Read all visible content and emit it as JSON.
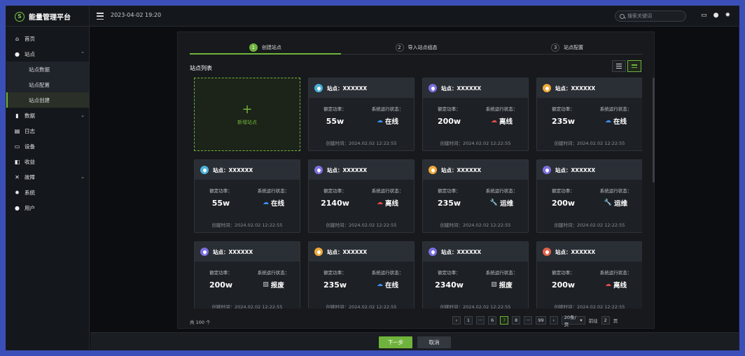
{
  "app": {
    "title": "能量管理平台"
  },
  "header": {
    "datetime": "2023-04-02 19:20",
    "search_placeholder": "搜索关键词"
  },
  "sidebar": {
    "items": [
      {
        "icon": "home-icon",
        "glyph": "⌂",
        "label": "首页"
      },
      {
        "icon": "location-icon",
        "glyph": "●",
        "label": "站点",
        "expanded": true,
        "children": [
          "站点数据",
          "站点配置",
          "站点创建"
        ]
      },
      {
        "icon": "bar-chart-icon",
        "glyph": "▮",
        "label": "数据",
        "collapsible": true
      },
      {
        "icon": "log-icon",
        "glyph": "▤",
        "label": "日志"
      },
      {
        "icon": "device-icon",
        "glyph": "▭",
        "label": "设备"
      },
      {
        "icon": "revenue-icon",
        "glyph": "◧",
        "label": "收益"
      },
      {
        "icon": "fault-icon",
        "glyph": "✕",
        "label": "故障",
        "collapsible": true
      },
      {
        "icon": "system-icon",
        "glyph": "✹",
        "label": "系统"
      },
      {
        "icon": "user-icon",
        "glyph": "●",
        "label": "用户"
      }
    ],
    "active_child": "站点创建"
  },
  "steps": [
    {
      "num": "1",
      "label": "创建站点",
      "active": true
    },
    {
      "num": "2",
      "label": "导入站点组态",
      "active": false
    },
    {
      "num": "3",
      "label": "站点配置",
      "active": false
    }
  ],
  "list": {
    "title": "站点列表",
    "new_label": "新增站点",
    "new_plus": "+"
  },
  "card_labels": {
    "power": "额定功率：",
    "status": "系统运行状态：",
    "created_prefix": "创建时间："
  },
  "cards": [
    {
      "name": "站点：XXXXXX",
      "pin_color": "#4ab2d8",
      "power": "55w",
      "status": "在线",
      "status_icon": "cloud-online-icon",
      "status_color": "#3d8ef0",
      "created": "2024.02.02 12:22:55"
    },
    {
      "name": "站点：XXXXXX",
      "pin_color": "#7b6fe0",
      "power": "200w",
      "status": "离线",
      "status_icon": "cloud-offline-icon",
      "status_color": "#e04b4b",
      "created": "2024.02.02 12:22:55"
    },
    {
      "name": "站点：XXXXXX",
      "pin_color": "#f0a93a",
      "power": "235w",
      "status": "在线",
      "status_icon": "cloud-online-icon",
      "status_color": "#3d8ef0",
      "created": "2024.02.02 12:22:55"
    },
    {
      "name": "站点：XXXXXX",
      "pin_color": "#4ab2d8",
      "power": "55w",
      "status": "在线",
      "status_icon": "cloud-online-icon",
      "status_color": "#3d8ef0",
      "created": "2024.02.02 12:22:55"
    },
    {
      "name": "站点：XXXXXX",
      "pin_color": "#7b6fe0",
      "power": "2140w",
      "status": "离线",
      "status_icon": "cloud-offline-icon",
      "status_color": "#e04b4b",
      "created": "2024.02.02 12:22:55"
    },
    {
      "name": "站点：XXXXXX",
      "pin_color": "#f0a93a",
      "power": "235w",
      "status": "运维",
      "status_icon": "wrench-icon",
      "status_color": "#f0b93a",
      "created": "2024.02.02 12:22:55"
    },
    {
      "name": "站点：XXXXXX",
      "pin_color": "#7b6fe0",
      "power": "200w",
      "status": "运维",
      "status_icon": "wrench-icon",
      "status_color": "#f0b93a",
      "created": "2024.02.02 12:22:55"
    },
    {
      "name": "站点：XXXXXX",
      "pin_color": "#7b6fe0",
      "power": "200w",
      "status": "报废",
      "status_icon": "scrapped-icon",
      "status_color": "#c5c9ce",
      "created": "2024.02.02 12:22:55"
    },
    {
      "name": "站点：XXXXXX",
      "pin_color": "#f0a93a",
      "power": "235w",
      "status": "在线",
      "status_icon": "cloud-online-icon",
      "status_color": "#3d8ef0",
      "created": "2024.02.02 12:22:55"
    },
    {
      "name": "站点：XXXXXX",
      "pin_color": "#7b6fe0",
      "power": "2340w",
      "status": "报废",
      "status_icon": "scrapped-icon",
      "status_color": "#c5c9ce",
      "created": "2024.02.02 12:22:55"
    },
    {
      "name": "站点：XXXXXX",
      "pin_color": "#e0644b",
      "power": "200w",
      "status": "离线",
      "status_icon": "cloud-offline-icon",
      "status_color": "#e04b4b",
      "created": "2024.02.02 12:22:55"
    }
  ],
  "pagination": {
    "total": "共 100 个",
    "prev": "‹",
    "next": "›",
    "pages": [
      "1",
      "···",
      "6",
      "7",
      "8",
      "···",
      "99"
    ],
    "current": "7",
    "page_size": "20条/页",
    "goto_label": "前往",
    "goto_value": "2",
    "page_unit": "页"
  },
  "footer": {
    "next_label": "下一步",
    "cancel_label": "取消"
  },
  "colors": {
    "accent": "#6fb33c",
    "online": "#3d8ef0",
    "offline": "#e04b4b",
    "maintenance": "#f0b93a"
  }
}
